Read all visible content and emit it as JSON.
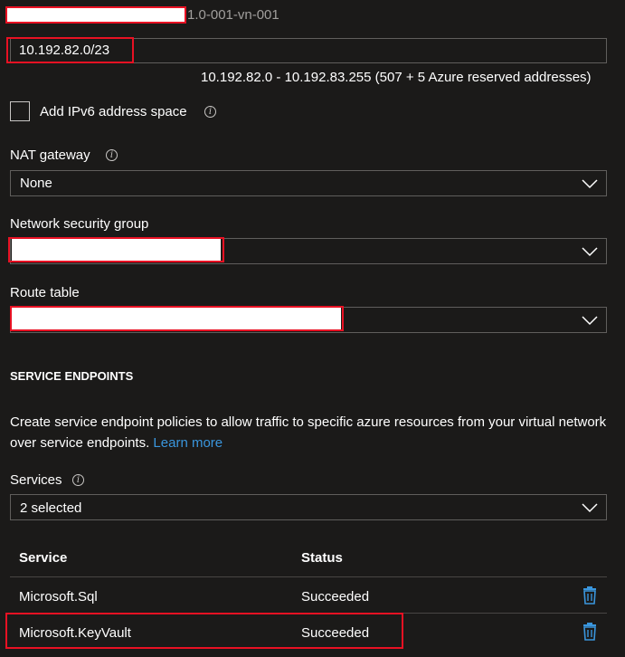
{
  "header": {
    "name_suffix": "1.0-001-vn-001"
  },
  "address_range": {
    "value": "10.192.82.0/23",
    "hint": "10.192.82.0 - 10.192.83.255 (507 + 5 Azure reserved addresses)"
  },
  "ipv6": {
    "label": "Add IPv6 address space"
  },
  "nat_gateway": {
    "label": "NAT gateway",
    "value": "None"
  },
  "nsg": {
    "label": "Network security group"
  },
  "route_table": {
    "label": "Route table"
  },
  "service_endpoints": {
    "heading": "SERVICE ENDPOINTS",
    "description": "Create service endpoint policies to allow traffic to specific azure resources from your virtual network over service endpoints.",
    "learn_more": "Learn more",
    "services_label": "Services",
    "services_value": "2 selected",
    "table": {
      "columns": [
        "Service",
        "Status"
      ],
      "rows": [
        {
          "service": "Microsoft.Sql",
          "status": "Succeeded"
        },
        {
          "service": "Microsoft.KeyVault",
          "status": "Succeeded"
        }
      ]
    }
  },
  "icons": {
    "info": "i",
    "delete": "trash-icon",
    "dropdown": "chevron-down-icon"
  },
  "colors": {
    "background": "#1b1a19",
    "border": "#605e5c",
    "accent": "#3a96dd",
    "highlight": "#e81123"
  }
}
